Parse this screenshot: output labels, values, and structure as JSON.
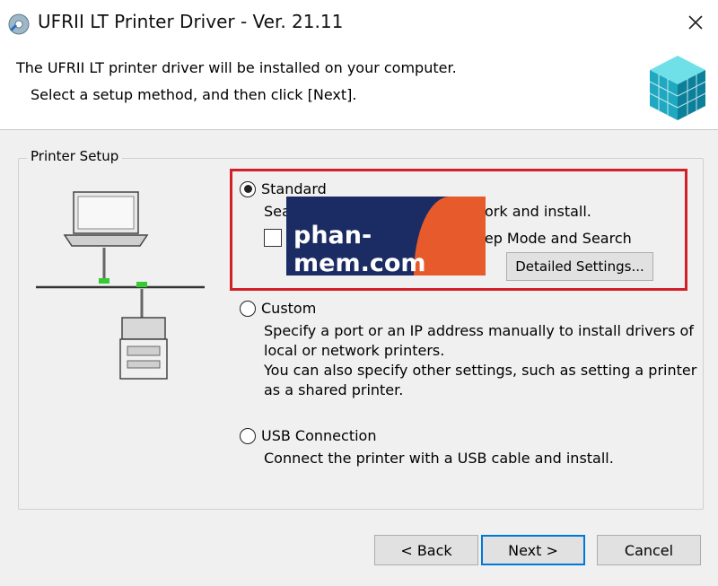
{
  "window": {
    "title": "UFRII LT Printer Driver - Ver. 21.11"
  },
  "header": {
    "line1": "The UFRII LT printer driver will be installed on your computer.",
    "line2": "Select a setup method, and then click [Next]."
  },
  "group": {
    "label": "Printer Setup"
  },
  "options": {
    "standard": {
      "label": "Standard",
      "selected": true,
      "desc_visible": "Sea",
      "desc_visible_end": "ork and install.",
      "checkbox_label_visible": "eep Mode and Search",
      "checkbox_checked": false,
      "detail_button": "Detailed Settings..."
    },
    "custom": {
      "label": "Custom",
      "selected": false,
      "desc": [
        "Specify a port or an IP address manually to install drivers of",
        "local or network printers.",
        "You can also specify other settings, such as setting a printer",
        "as a shared printer."
      ]
    },
    "usb": {
      "label": "USB Connection",
      "selected": false,
      "desc": "Connect the printer with a USB cable and install."
    }
  },
  "watermark": {
    "text": "phan-mem.com"
  },
  "buttons": {
    "back": "< Back",
    "next": "Next >",
    "cancel": "Cancel"
  },
  "colors": {
    "highlight": "#d21f2a",
    "default_button_border": "#0078d7",
    "watermark_navy": "#1b2b63",
    "watermark_orange": "#e65a2b"
  }
}
